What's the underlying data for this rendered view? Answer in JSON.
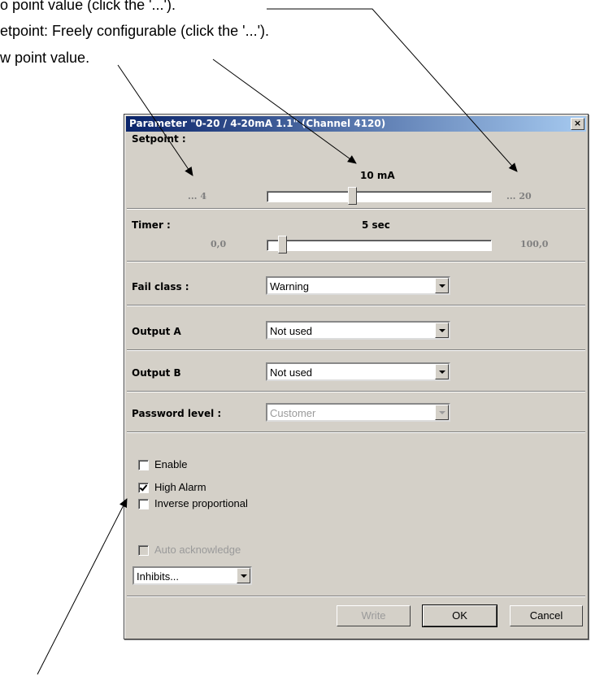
{
  "annotations": {
    "line1": "o point value (click the '...').",
    "line2": "etpoint: Freely configurable (click the '...').",
    "line3": "w point value."
  },
  "dialog": {
    "title": "Parameter \"0-20 / 4-20mA 1.1\" (Channel 4120)",
    "close_glyph": "×",
    "setpoint": {
      "label": "Setpoint :",
      "value_text": "10 mA",
      "min_text": "... 4",
      "max_text": "... 20",
      "min": 4,
      "max": 20,
      "value": 10
    },
    "timer": {
      "label": "Timer :",
      "value_text": "5 sec",
      "min_text": "0,0",
      "max_text": "100,0",
      "min": 0,
      "max": 100,
      "value": 5
    },
    "fail_class": {
      "label": "Fail class :",
      "value": "Warning"
    },
    "output_a": {
      "label": "Output A",
      "value": "Not used"
    },
    "output_b": {
      "label": "Output B",
      "value": "Not used"
    },
    "password_level": {
      "label": "Password level :",
      "value": "Customer"
    },
    "checkboxes": {
      "enable": {
        "label": "Enable",
        "checked": false
      },
      "high_alarm": {
        "label": "High Alarm",
        "checked": true
      },
      "inverse": {
        "label": "Inverse proportional",
        "checked": false
      },
      "auto_ack": {
        "label": "Auto acknowledge",
        "checked": false
      }
    },
    "inhibits": {
      "value": "Inhibits..."
    },
    "buttons": {
      "write": "Write",
      "ok": "OK",
      "cancel": "Cancel"
    }
  }
}
